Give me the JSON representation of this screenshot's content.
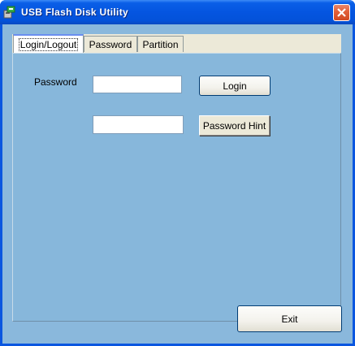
{
  "window": {
    "title": "USB Flash Disk Utility",
    "icon": "usb-disk-icon",
    "close_icon": "close-icon"
  },
  "tabs": [
    {
      "label": "Login/Logout",
      "selected": true
    },
    {
      "label": "Password",
      "selected": false
    },
    {
      "label": "Partition",
      "selected": false
    }
  ],
  "login_tab": {
    "password_label": "Password",
    "password_value": "",
    "hint_value": "",
    "login_button": "Login",
    "hint_button": "Password Hint"
  },
  "footer": {
    "exit_button": "Exit"
  },
  "colors": {
    "title_bar": "#0555e0",
    "client_background": "#8ab8dc",
    "close_button": "#e2613b"
  }
}
